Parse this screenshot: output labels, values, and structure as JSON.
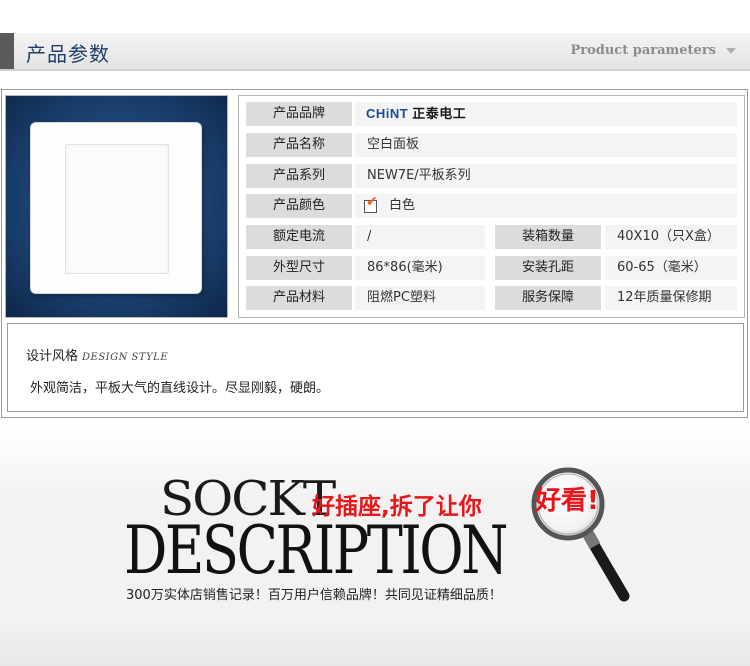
{
  "header": {
    "title": "产品参数",
    "subtitle": "Product parameters"
  },
  "brand": {
    "logo_latin": "CHiNT",
    "logo_cn": "正泰电工"
  },
  "specs": [
    {
      "label": "产品品牌",
      "value": ""
    },
    {
      "label": "产品名称",
      "value": "空白面板"
    },
    {
      "label": "产品系列",
      "value": "NEW7E/平板系列"
    },
    {
      "label": "产品颜色",
      "value": "白色"
    },
    {
      "label": "额定电流",
      "value": "/",
      "label2": "装箱数量",
      "value2": "40X10（只X盒）"
    },
    {
      "label": "外型尺寸",
      "value": "86*86(毫米)",
      "label2": "安装孔距",
      "value2": "60-65（毫米）"
    },
    {
      "label": "产品材料",
      "value": "阻燃PC塑料",
      "label2": "服务保障",
      "value2": "12年质量保修期"
    }
  ],
  "design": {
    "title": "设计风格",
    "subtitle": "DESIGN STYLE",
    "text": "外观简洁，平板大气的直线设计。尽显刚毅，硬朗。"
  },
  "banner": {
    "line1": "SOCKT",
    "line2": "DESCRIPTION",
    "slogan_a": "好插座,拆了让你",
    "slogan_b": "好看!",
    "tagline": "300万实体店销售记录！百万用户信赖品牌！共同见证精细品质！"
  },
  "colors": {
    "header_title": "#1f3f66",
    "brand_blue": "#1a4d9c",
    "slogan_red": "#e8151b",
    "check_orange": "#e8651a",
    "photo_bg": "#173a66"
  },
  "icons": [
    "dropdown-arrow-icon",
    "checkbox-checked-icon",
    "magnifier-icon"
  ]
}
